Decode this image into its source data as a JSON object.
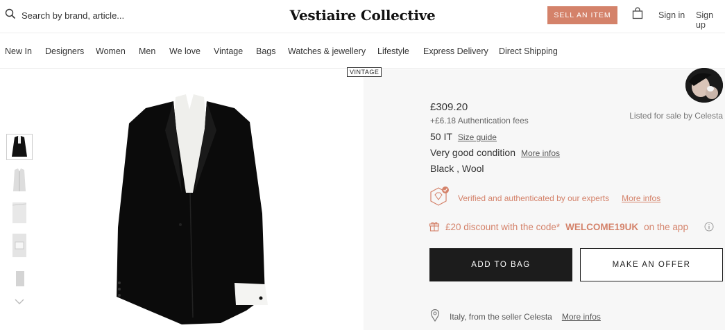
{
  "header": {
    "search_placeholder": "Search by brand, article...",
    "logo": "Vestiaire Collective",
    "sell_label": "SELL AN ITEM",
    "sign_in": "Sign in",
    "sign_up": "Sign up",
    "accent_color": "#d4826a"
  },
  "nav": {
    "items": [
      "New In",
      "Designers",
      "Women",
      "Men",
      "We love",
      "Vintage",
      "Bags",
      "Watches & jewellery",
      "Lifestyle",
      "Express Delivery",
      "Direct Shipping"
    ]
  },
  "gallery": {
    "tag": "VINTAGE",
    "thumbnails": [
      "jacket-front",
      "shirt",
      "detail-1",
      "detail-2",
      "detail-3"
    ]
  },
  "product": {
    "price": "£309.20",
    "fees": "+£6.18 Authentication fees",
    "seller_listed": "Listed for sale by Celesta",
    "size": "50 IT",
    "size_guide": "Size guide",
    "condition": "Very good condition",
    "condition_link": "More infos",
    "material": "Black , Wool",
    "verified_text": "Verified and authenticated by our experts",
    "verified_link": "More infos",
    "discount_prefix": "£20 discount with the code*",
    "discount_code": "WELCOME19UK",
    "discount_suffix": "on the app",
    "add_to_bag": "ADD TO BAG",
    "make_offer": "MAKE AN OFFER",
    "location": "Italy, from the seller Celesta",
    "location_link": "More infos"
  }
}
